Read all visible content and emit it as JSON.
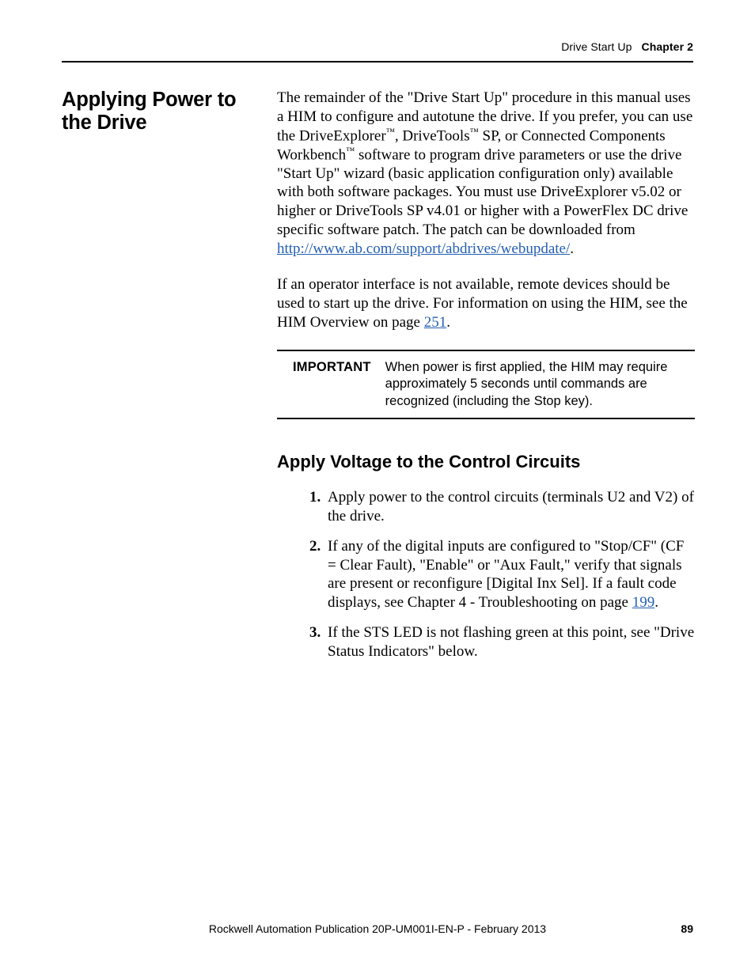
{
  "running_head": {
    "section": "Drive Start Up",
    "chapter": "Chapter 2"
  },
  "section_title": "Applying Power to the Drive",
  "para1": {
    "t1": "The remainder of the \"Drive Start Up\" procedure in this manual uses a HIM to configure and autotune the drive. If you prefer, you can use the DriveExplorer",
    "tm1": "™",
    "t2": ", DriveTools",
    "tm2": "™",
    "t3": " SP, or Connected Components Workbench",
    "tm3": "™",
    "t4": " software to program drive parameters or use the drive \"Start Up\" wizard (basic application configuration only) available with both software packages. You must use DriveExplorer v5.02 or higher or DriveTools SP v4.01 or higher with a PowerFlex DC drive specific software patch. The patch can be downloaded from ",
    "link_text": "http://www.ab.com/support/abdrives/webupdate/",
    "t5": "."
  },
  "para2": {
    "t1": "If an operator interface is not available, remote devices should be used to start up the drive. For information on using the HIM, see the HIM Overview on page ",
    "link_text": "251",
    "t2": "."
  },
  "important": {
    "label": "IMPORTANT",
    "text": "When power is first applied, the HIM may require approximately 5 seconds until commands are recognized (including the Stop key)."
  },
  "subsection_title": "Apply Voltage to the Control Circuits",
  "steps": {
    "s1": "Apply power to the control circuits (terminals U2 and V2) of the drive.",
    "s2_a": "If any of the digital inputs are configured to \"Stop/CF\" (CF = Clear Fault), \"Enable\" or \"Aux Fault,\" verify that signals are present or reconfigure [Digital Inx Sel]. If a fault code displays, see Chapter 4 - Troubleshooting on page ",
    "s2_link": "199",
    "s2_b": ".",
    "s3": "If the STS LED is not flashing green at this point, see \"Drive Status Indicators\" below."
  },
  "footer": {
    "publication": "Rockwell Automation Publication 20P-UM001I-EN-P - February 2013",
    "page": "89"
  }
}
